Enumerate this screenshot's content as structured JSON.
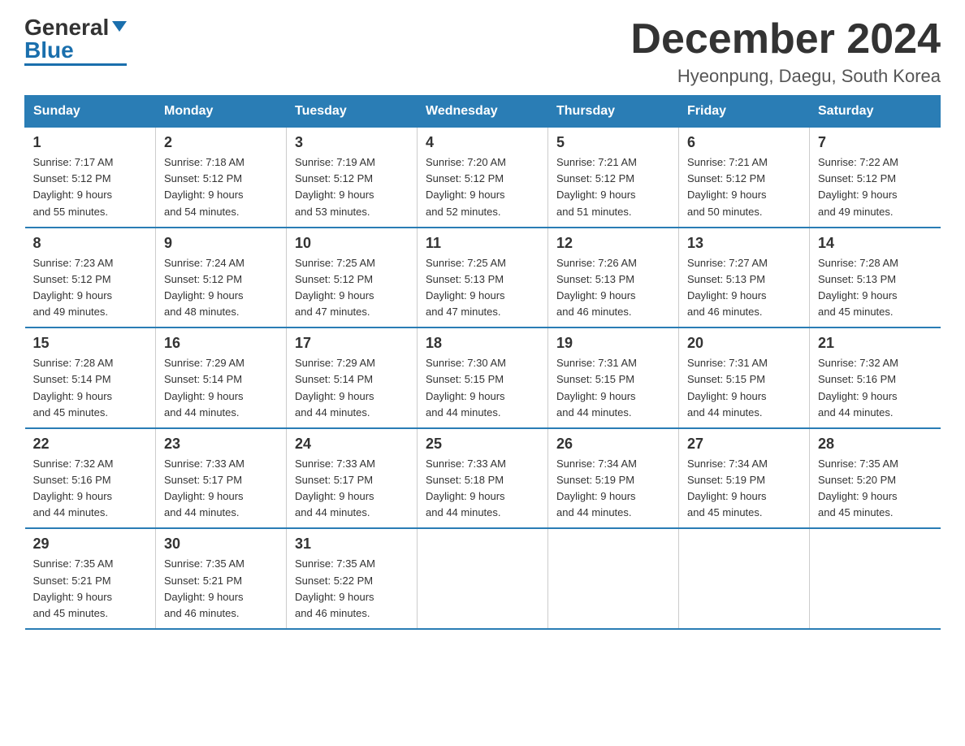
{
  "logo": {
    "general": "General",
    "blue": "Blue"
  },
  "title": "December 2024",
  "location": "Hyeonpung, Daegu, South Korea",
  "days_of_week": [
    "Sunday",
    "Monday",
    "Tuesday",
    "Wednesday",
    "Thursday",
    "Friday",
    "Saturday"
  ],
  "weeks": [
    [
      {
        "day": "1",
        "sunrise": "7:17 AM",
        "sunset": "5:12 PM",
        "daylight": "9 hours and 55 minutes."
      },
      {
        "day": "2",
        "sunrise": "7:18 AM",
        "sunset": "5:12 PM",
        "daylight": "9 hours and 54 minutes."
      },
      {
        "day": "3",
        "sunrise": "7:19 AM",
        "sunset": "5:12 PM",
        "daylight": "9 hours and 53 minutes."
      },
      {
        "day": "4",
        "sunrise": "7:20 AM",
        "sunset": "5:12 PM",
        "daylight": "9 hours and 52 minutes."
      },
      {
        "day": "5",
        "sunrise": "7:21 AM",
        "sunset": "5:12 PM",
        "daylight": "9 hours and 51 minutes."
      },
      {
        "day": "6",
        "sunrise": "7:21 AM",
        "sunset": "5:12 PM",
        "daylight": "9 hours and 50 minutes."
      },
      {
        "day": "7",
        "sunrise": "7:22 AM",
        "sunset": "5:12 PM",
        "daylight": "9 hours and 49 minutes."
      }
    ],
    [
      {
        "day": "8",
        "sunrise": "7:23 AM",
        "sunset": "5:12 PM",
        "daylight": "9 hours and 49 minutes."
      },
      {
        "day": "9",
        "sunrise": "7:24 AM",
        "sunset": "5:12 PM",
        "daylight": "9 hours and 48 minutes."
      },
      {
        "day": "10",
        "sunrise": "7:25 AM",
        "sunset": "5:12 PM",
        "daylight": "9 hours and 47 minutes."
      },
      {
        "day": "11",
        "sunrise": "7:25 AM",
        "sunset": "5:13 PM",
        "daylight": "9 hours and 47 minutes."
      },
      {
        "day": "12",
        "sunrise": "7:26 AM",
        "sunset": "5:13 PM",
        "daylight": "9 hours and 46 minutes."
      },
      {
        "day": "13",
        "sunrise": "7:27 AM",
        "sunset": "5:13 PM",
        "daylight": "9 hours and 46 minutes."
      },
      {
        "day": "14",
        "sunrise": "7:28 AM",
        "sunset": "5:13 PM",
        "daylight": "9 hours and 45 minutes."
      }
    ],
    [
      {
        "day": "15",
        "sunrise": "7:28 AM",
        "sunset": "5:14 PM",
        "daylight": "9 hours and 45 minutes."
      },
      {
        "day": "16",
        "sunrise": "7:29 AM",
        "sunset": "5:14 PM",
        "daylight": "9 hours and 44 minutes."
      },
      {
        "day": "17",
        "sunrise": "7:29 AM",
        "sunset": "5:14 PM",
        "daylight": "9 hours and 44 minutes."
      },
      {
        "day": "18",
        "sunrise": "7:30 AM",
        "sunset": "5:15 PM",
        "daylight": "9 hours and 44 minutes."
      },
      {
        "day": "19",
        "sunrise": "7:31 AM",
        "sunset": "5:15 PM",
        "daylight": "9 hours and 44 minutes."
      },
      {
        "day": "20",
        "sunrise": "7:31 AM",
        "sunset": "5:15 PM",
        "daylight": "9 hours and 44 minutes."
      },
      {
        "day": "21",
        "sunrise": "7:32 AM",
        "sunset": "5:16 PM",
        "daylight": "9 hours and 44 minutes."
      }
    ],
    [
      {
        "day": "22",
        "sunrise": "7:32 AM",
        "sunset": "5:16 PM",
        "daylight": "9 hours and 44 minutes."
      },
      {
        "day": "23",
        "sunrise": "7:33 AM",
        "sunset": "5:17 PM",
        "daylight": "9 hours and 44 minutes."
      },
      {
        "day": "24",
        "sunrise": "7:33 AM",
        "sunset": "5:17 PM",
        "daylight": "9 hours and 44 minutes."
      },
      {
        "day": "25",
        "sunrise": "7:33 AM",
        "sunset": "5:18 PM",
        "daylight": "9 hours and 44 minutes."
      },
      {
        "day": "26",
        "sunrise": "7:34 AM",
        "sunset": "5:19 PM",
        "daylight": "9 hours and 44 minutes."
      },
      {
        "day": "27",
        "sunrise": "7:34 AM",
        "sunset": "5:19 PM",
        "daylight": "9 hours and 45 minutes."
      },
      {
        "day": "28",
        "sunrise": "7:35 AM",
        "sunset": "5:20 PM",
        "daylight": "9 hours and 45 minutes."
      }
    ],
    [
      {
        "day": "29",
        "sunrise": "7:35 AM",
        "sunset": "5:21 PM",
        "daylight": "9 hours and 45 minutes."
      },
      {
        "day": "30",
        "sunrise": "7:35 AM",
        "sunset": "5:21 PM",
        "daylight": "9 hours and 46 minutes."
      },
      {
        "day": "31",
        "sunrise": "7:35 AM",
        "sunset": "5:22 PM",
        "daylight": "9 hours and 46 minutes."
      },
      null,
      null,
      null,
      null
    ]
  ],
  "labels": {
    "sunrise": "Sunrise:",
    "sunset": "Sunset:",
    "daylight": "Daylight:"
  }
}
